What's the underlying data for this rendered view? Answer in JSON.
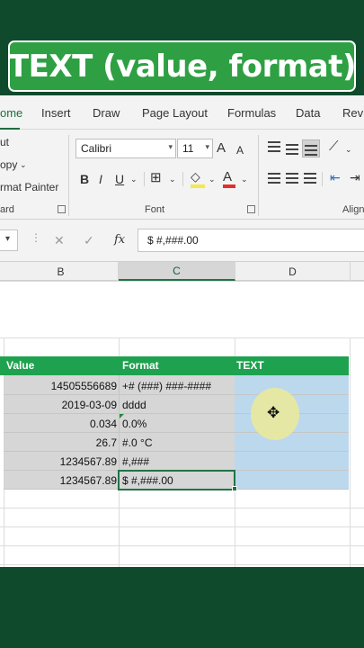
{
  "title": "TEXT (value, format)",
  "ribbon_tabs": [
    "ome",
    "Insert",
    "Draw",
    "Page Layout",
    "Formulas",
    "Data",
    "Revi"
  ],
  "clipboard": {
    "cut": "ut",
    "copy": "opy",
    "format_painter": "rmat Painter",
    "group_label": "ard"
  },
  "font": {
    "name": "Calibri",
    "size": "11",
    "bold": "B",
    "italic": "I",
    "underline": "U",
    "grow": "A",
    "shrink": "A",
    "font_color": "A",
    "group_label": "Font"
  },
  "alignment": {
    "group_label": "Align"
  },
  "formula_bar": {
    "fx": "fx",
    "cancel": "✕",
    "confirm": "✓",
    "content": "$ #,###.00"
  },
  "columns": {
    "b": "B",
    "c": "C",
    "d": "D"
  },
  "table": {
    "headers": [
      "Value",
      "Format",
      "TEXT"
    ],
    "rows": [
      {
        "value": "14505556689",
        "format": "+# (###) ###-####"
      },
      {
        "value": "2019-03-09",
        "format": "dddd"
      },
      {
        "value": "0.034",
        "format": "0.0%"
      },
      {
        "value": "26.7",
        "format": "#.0 °C"
      },
      {
        "value": "1234567.89",
        "format": "#,###"
      },
      {
        "value": "1234567.89",
        "format": "$ #,###.00"
      }
    ]
  },
  "colors": {
    "brand_dark": "#0f4a2c",
    "title_green": "#2ea043",
    "header_green": "#1ea24f",
    "selection_blue": "#bcd8ed",
    "excel_green": "#217346"
  },
  "icons": [
    "dropdown-arrow-icon",
    "cancel-icon",
    "confirm-icon",
    "fx-icon",
    "plus-cursor-icon"
  ]
}
